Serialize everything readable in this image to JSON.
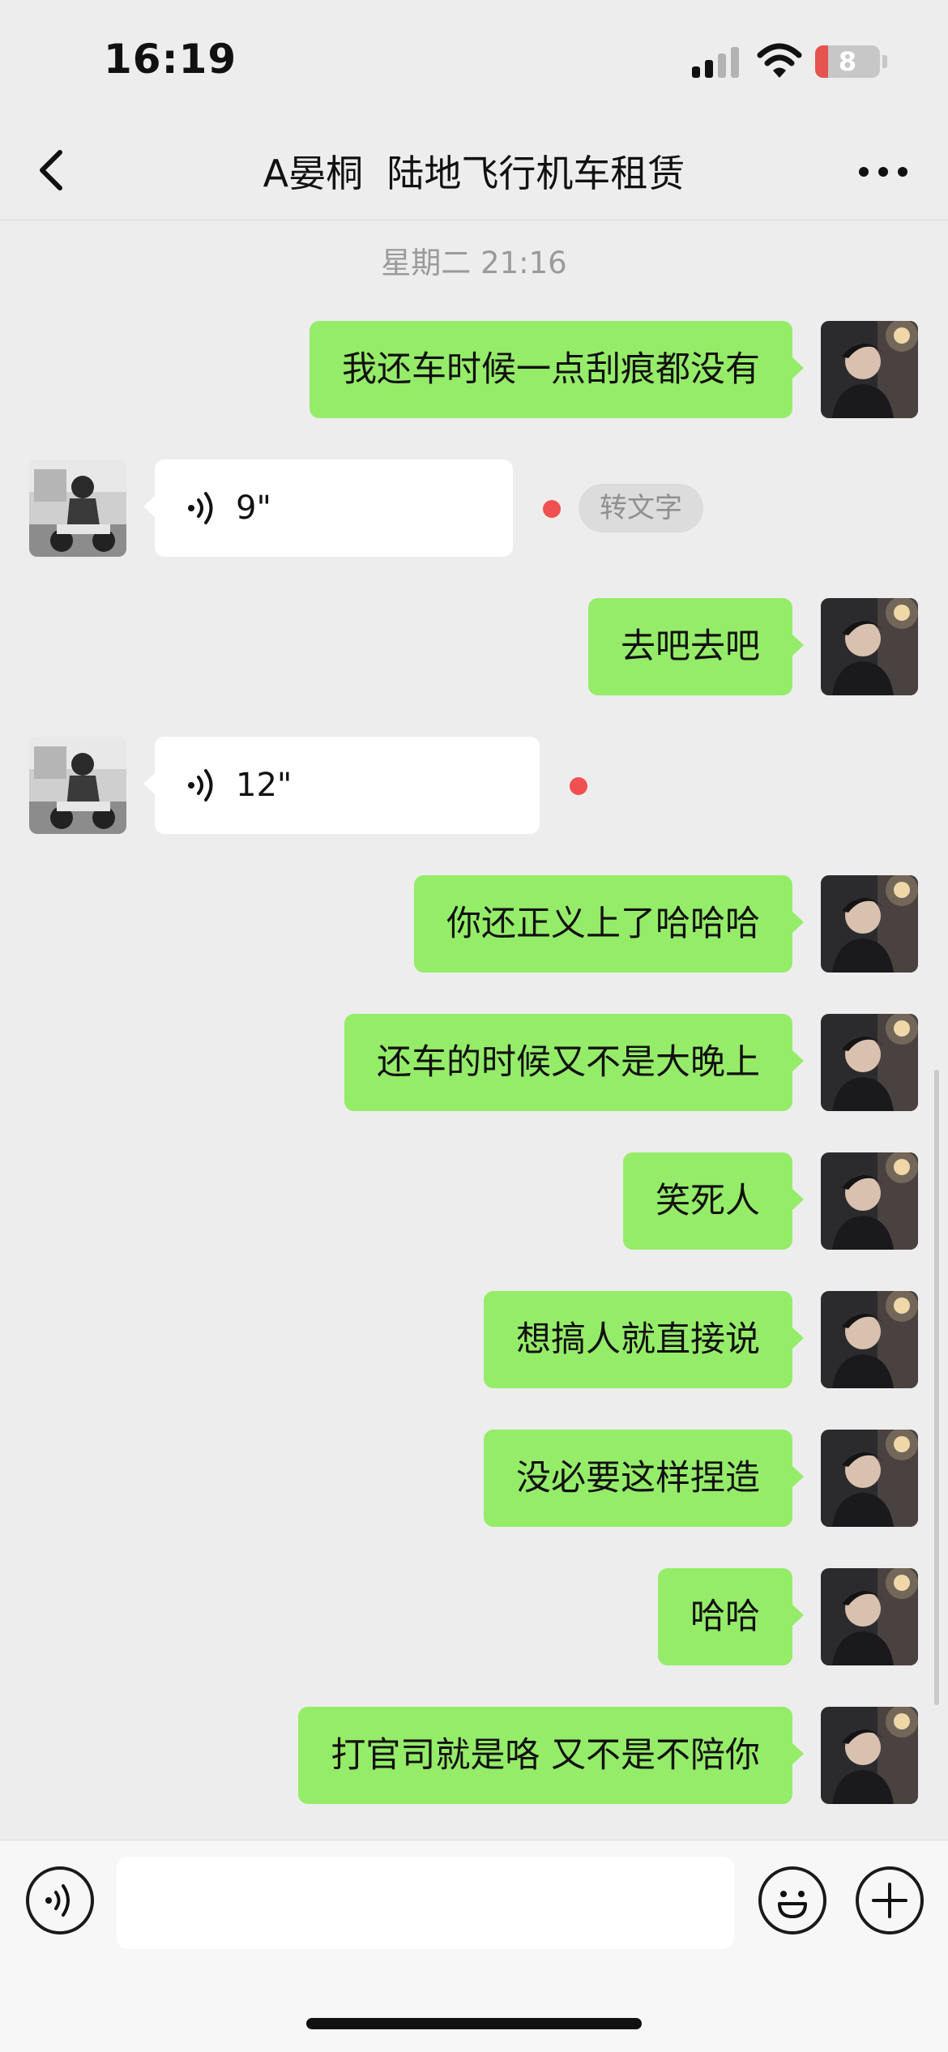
{
  "status_bar": {
    "time": "16:19",
    "battery_level": "8",
    "signal_icon": "cellular-signal-icon",
    "wifi_icon": "wifi-icon"
  },
  "header": {
    "back_icon": "chevron-left-icon",
    "title": "A晏桐  陆地飞行机车租赁",
    "more_icon": "more-dots-icon"
  },
  "chat": {
    "timestamp": "星期二 21:16",
    "messages": [
      {
        "sender": "me",
        "type": "text",
        "text": "我还车时候一点刮痕都没有"
      },
      {
        "sender": "other",
        "type": "voice",
        "duration": "9\"",
        "unread": true,
        "convert_label": "转文字"
      },
      {
        "sender": "me",
        "type": "text",
        "text": "去吧去吧"
      },
      {
        "sender": "other",
        "type": "voice",
        "duration": "12\"",
        "unread": true
      },
      {
        "sender": "me",
        "type": "text",
        "text": "你还正义上了哈哈哈"
      },
      {
        "sender": "me",
        "type": "text",
        "text": "还车的时候又不是大晚上"
      },
      {
        "sender": "me",
        "type": "text",
        "text": "笑死人"
      },
      {
        "sender": "me",
        "type": "text",
        "text": "想搞人就直接说"
      },
      {
        "sender": "me",
        "type": "text",
        "text": "没必要这样捏造"
      },
      {
        "sender": "me",
        "type": "text",
        "text": "哈哈"
      },
      {
        "sender": "me",
        "type": "text",
        "text": "打官司就是咯 又不是不陪你"
      }
    ]
  },
  "input_bar": {
    "voice_icon": "voice-input-icon",
    "text_value": "",
    "emoji_icon": "emoji-icon",
    "plus_icon": "plus-icon"
  },
  "colors": {
    "background": "#ededed",
    "my_bubble": "#95ec69",
    "other_bubble": "#ffffff",
    "unread_dot": "#f05050",
    "battery_low": "#e5544f"
  }
}
